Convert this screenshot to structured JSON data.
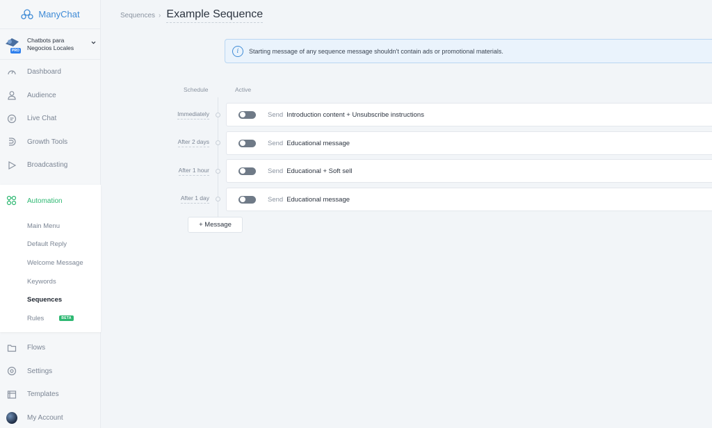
{
  "app": {
    "name": "ManyChat"
  },
  "account": {
    "name_line1": "Chatbots para",
    "name_line2": "Negocios Locales",
    "badge": "PRO"
  },
  "sidebar": {
    "top_items": [
      {
        "label": "Dashboard",
        "icon": "dashboard-icon"
      },
      {
        "label": "Audience",
        "icon": "user-icon"
      },
      {
        "label": "Live Chat",
        "icon": "chat-icon"
      },
      {
        "label": "Growth Tools",
        "icon": "magnet-icon"
      },
      {
        "label": "Broadcasting",
        "icon": "play-icon"
      }
    ],
    "automation": {
      "label": "Automation",
      "items": [
        {
          "label": "Main Menu"
        },
        {
          "label": "Default Reply"
        },
        {
          "label": "Welcome Message"
        },
        {
          "label": "Keywords"
        },
        {
          "label": "Sequences",
          "active": true
        },
        {
          "label": "Rules",
          "badge": "BETA"
        }
      ]
    },
    "bottom_items": [
      {
        "label": "Flows",
        "icon": "folder-icon"
      },
      {
        "label": "Settings",
        "icon": "gear-icon"
      },
      {
        "label": "Templates",
        "icon": "template-icon"
      },
      {
        "label": "My Account",
        "icon": "avatar"
      }
    ]
  },
  "header": {
    "breadcrumb": "Sequences",
    "title": "Example Sequence"
  },
  "banner": {
    "text": "Starting message of any sequence message shouldn't contain ads or promotional materials."
  },
  "columns": {
    "schedule": "Schedule",
    "active": "Active"
  },
  "send_label": "Send",
  "messages": [
    {
      "schedule": "Immediately",
      "name": "Introduction content + Unsubscribe instructions",
      "active": false
    },
    {
      "schedule": "After 2 days",
      "name": "Educational message",
      "active": false
    },
    {
      "schedule": "After 1 hour",
      "name": "Educational + Soft sell",
      "active": false
    },
    {
      "schedule": "After 1 day",
      "name": "Educational message",
      "active": false
    }
  ],
  "add_message_label": "+ Message",
  "colors": {
    "accent_blue": "#3f8bd6",
    "accent_green": "#2eb872",
    "toggle_off": "#6f7a87"
  }
}
